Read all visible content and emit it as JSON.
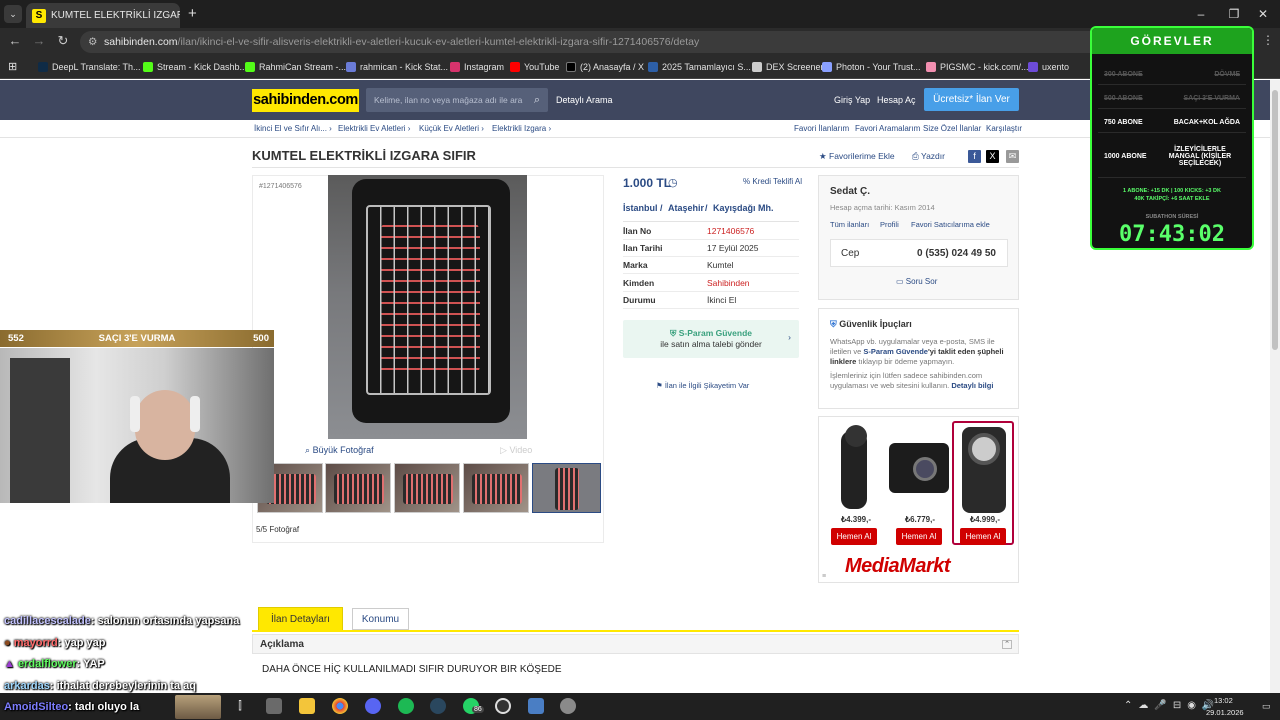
{
  "browser": {
    "tab_title": "KUMTEL ELEKTRİKLİ IZGARA SIF",
    "url_host": "sahibinden.com",
    "url_path": "/ilan/ikinci-el-ve-sifir-alisveris-elektrikli-ev-aletleri-kucuk-ev-aletleri-kumtel-elektrikli-izgara-sifir-1271406576/detay",
    "bookmarks": [
      "DeepL Translate: Th...",
      "Stream - Kick Dashb...",
      "RahmiCan Stream -...",
      "rahmican - Kick Stat...",
      "Instagram",
      "YouTube",
      "(2) Anasayfa / X",
      "2025 Tamamlayıcı S...",
      "DEX Screener",
      "Photon - Your Trust...",
      "PIGSMC - kick.com/...",
      "uxento"
    ]
  },
  "site": {
    "logo": "sahibinden.com",
    "search_placeholder": "Kelime, ilan no veya mağaza adı ile ara",
    "detailed_search": "Detaylı Arama",
    "login": "Giriş Yap",
    "register": "Hesap Aç",
    "free_ad": "Ücretsiz* İlan Ver"
  },
  "crumbs": [
    "İkinci El ve Sıfır Alı...",
    "Elektrikli Ev Aletleri",
    "Küçük Ev Aletleri",
    "Elektrikli Izgara"
  ],
  "favlinks": [
    "Favori İlanlarım",
    "Favori Aramalarım",
    "Size Özel İlanlar",
    "Karşılaştır"
  ],
  "listing": {
    "title": "KUMTEL ELEKTRİKLİ IZGARA SIFIR",
    "fav": "Favorilerime Ekle",
    "print": "Yazdır",
    "id_tag": "#1271406576",
    "price": "1.000 TL",
    "credit": "Kredi Teklifi Al",
    "city": "İstanbul",
    "district": "Ataşehir",
    "hood": "Kayışdağı Mh.",
    "rows": [
      {
        "k": "İlan No",
        "v": "1271406576"
      },
      {
        "k": "İlan Tarihi",
        "v": "17 Eylül 2025"
      },
      {
        "k": "Marka",
        "v": "Kumtel"
      },
      {
        "k": "Kimden",
        "v": "Sahibinden"
      },
      {
        "k": "Durumu",
        "v": "İkinci El"
      }
    ],
    "sparam_title": "S-Param Güvende",
    "sparam_sub": "ile satın alma talebi gönder",
    "complain": "İlan ile İlgili Şikayetim Var",
    "big_photo": "Büyük Fotoğraf",
    "video": "Video",
    "photo_count": "5/5 Fotoğraf"
  },
  "seller": {
    "name": "Sedat Ç.",
    "since": "Hesap açma tarihi: Kasım 2014",
    "links": [
      "Tüm ilanları",
      "Profili",
      "Favori Satıcılarıma ekle"
    ],
    "phone_label": "Cep",
    "phone": "0 (535) 024 49 50",
    "ask": "Soru Sor"
  },
  "security": {
    "title": "Güvenlik İpuçları",
    "p1a": "WhatsApp vb. uygulamalar veya e-posta, SMS ile iletilen ve ",
    "p1b": "S-Param Güvende",
    "p1c": "'yi taklit eden şüpheli linklere",
    "p1d": " tıklayıp bir ödeme yapmayın.",
    "p2": "İşlemleriniz için lütfen sadece sahibinden.com uygulaması ve web sitesini kullanın. ",
    "more": "Detaylı bilgi"
  },
  "ad": {
    "prices": [
      "₺4.399,-",
      "₺6.779,-",
      "₺4.999,-"
    ],
    "btn": "Hemen Al",
    "brand": "MediaMarkt"
  },
  "tabs": {
    "details": "İlan Detayları",
    "location": "Konumu"
  },
  "description": {
    "heading": "Açıklama",
    "text": "DAHA ÖNCE HİÇ KULLANILMADI SIFIR DURUYOR BIR KÖŞEDE"
  },
  "overlay": {
    "left_num": "552",
    "label": "SAÇI 3'E VURMA",
    "right_num": "500",
    "chat": [
      {
        "user": "cadillacescalade",
        "msg": ": salonun ortasında yapsana"
      },
      {
        "user": "mayorrd",
        "msg": ": yap yap"
      },
      {
        "user": "erdalflower",
        "msg": ": YAP"
      },
      {
        "user": "arkardas",
        "msg": ": ithalat derebeylerinin ta aq"
      },
      {
        "user": "AmoidSilteo",
        "msg": ": tadı oluyo la"
      }
    ],
    "gorevler": {
      "title": "GÖREVLER",
      "rows": [
        {
          "a": "300 ABONE",
          "b": "DÖVME"
        },
        {
          "a": "500 ABONE",
          "b": "SAÇI 3'E VURMA"
        },
        {
          "a": "750 ABONE",
          "b": "BACAK+KOL AĞDA"
        },
        {
          "a": "1000 ABONE",
          "b": "İZLEYİCİLERLE MANGAL (KİŞİLER SEÇİLECEK)"
        }
      ],
      "note1": "1 ABONE: +15 DK | 100 KICKS: +3 DK",
      "note2": "40K TAKİPÇİ: +6 SAAT EKLE",
      "sub": "SUBATHON SÜRESİ",
      "timer": "07:43:02"
    }
  },
  "taskbar": {
    "time": "13:02",
    "date": "29.01.2026",
    "badge": "86"
  }
}
